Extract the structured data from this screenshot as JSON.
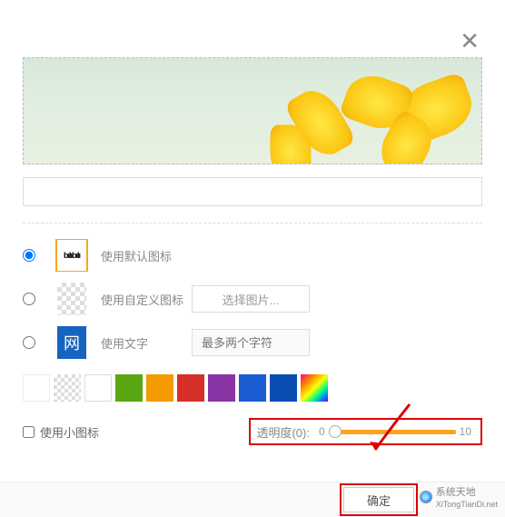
{
  "dialog": {
    "close_glyph": "✕"
  },
  "name_input": {
    "value": ""
  },
  "icon_options": {
    "default": {
      "label": "使用默认图标",
      "glyph": "bılıbılı"
    },
    "custom": {
      "label": "使用自定义图标",
      "action_text": "选择图片..."
    },
    "text": {
      "label": "使用文字",
      "glyph": "网",
      "placeholder": "最多两个字符"
    }
  },
  "small_icon": {
    "label": "使用小图标"
  },
  "opacity": {
    "label": "透明度(0):",
    "min": "0",
    "max": "10",
    "value": 0
  },
  "footer": {
    "ok_label": "确定"
  },
  "watermark": {
    "text": "系统天地",
    "url": "XiTongTianDi.net"
  },
  "colors": {
    "highlight": "#d00",
    "accent": "#f5a623"
  }
}
